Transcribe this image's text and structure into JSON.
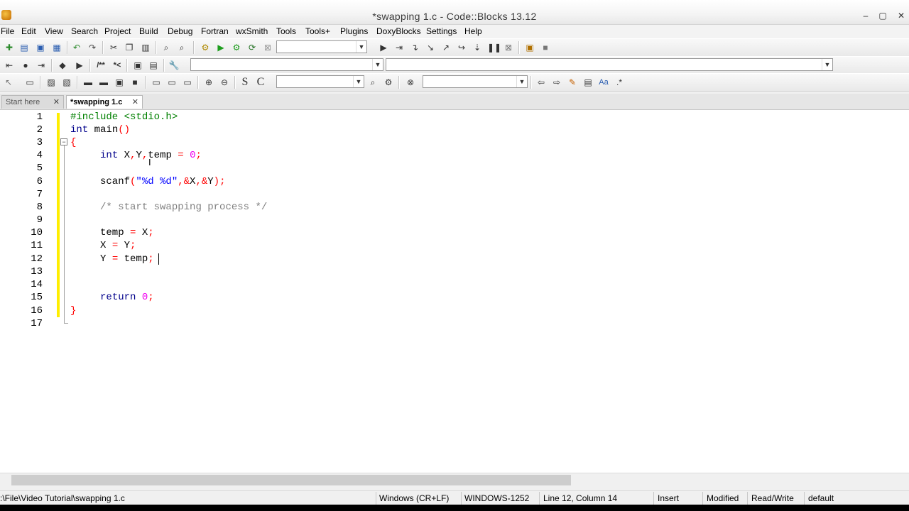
{
  "window": {
    "title": "*swapping 1.c - Code::Blocks 13.12",
    "minimize": "–",
    "maximize": "▢",
    "close": "✕"
  },
  "menu": [
    "File",
    "Edit",
    "View",
    "Search",
    "Project",
    "Build",
    "Debug",
    "Fortran",
    "wxSmith",
    "Tools",
    "Tools+",
    "Plugins",
    "DoxyBlocks",
    "Settings",
    "Help"
  ],
  "toolbar2": {
    "comment_block": "/**",
    "comment_line": "*<"
  },
  "toolbar3": {
    "s_label": "S",
    "c_label": "C",
    "star_label": ".*"
  },
  "tabs": [
    {
      "label": "Start here",
      "close": "✕"
    },
    {
      "label": "*swapping 1.c",
      "close": "✕"
    }
  ],
  "editor": {
    "line_numbers": [
      "1",
      "2",
      "3",
      "4",
      "5",
      "6",
      "7",
      "8",
      "9",
      "10",
      "11",
      "12",
      "13",
      "14",
      "15",
      "16",
      "17"
    ]
  },
  "status": {
    "path": ":\\File\\Video Tutorial\\swapping 1.c",
    "eol": "Windows (CR+LF)",
    "encoding": "WINDOWS-1252",
    "position": "Line 12, Column 14",
    "mode": "Insert",
    "modified": "Modified",
    "access": "Read/Write",
    "lang": "default"
  }
}
